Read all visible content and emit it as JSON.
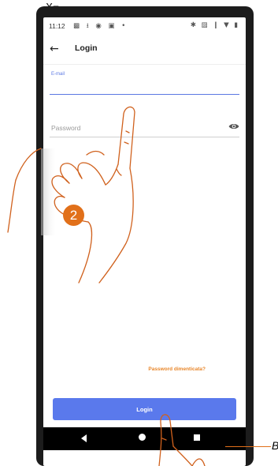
{
  "top_glyph": "X⧄",
  "status_bar": {
    "time": "11:12",
    "left_icons": "▩ ⭳ ◉ ▣ •",
    "right_icons": "✱ ▨ ❙ ▼ ▮"
  },
  "app_bar": {
    "back_icon": "←",
    "title": "Login"
  },
  "form": {
    "email_label": "E-mail",
    "email_value": "",
    "password_placeholder": "Password",
    "password_value": ""
  },
  "forgot_password": "Password dimenticata?",
  "login_button": "Login",
  "annotation": {
    "step_number": "2",
    "callout_letter": "B"
  },
  "colors": {
    "accent": "#5a79ec",
    "highlight": "#e1701a",
    "link": "#e8862a"
  },
  "icons": [
    "back-arrow-icon",
    "eye-icon",
    "nav-back-icon",
    "nav-home-icon",
    "nav-recent-icon"
  ]
}
